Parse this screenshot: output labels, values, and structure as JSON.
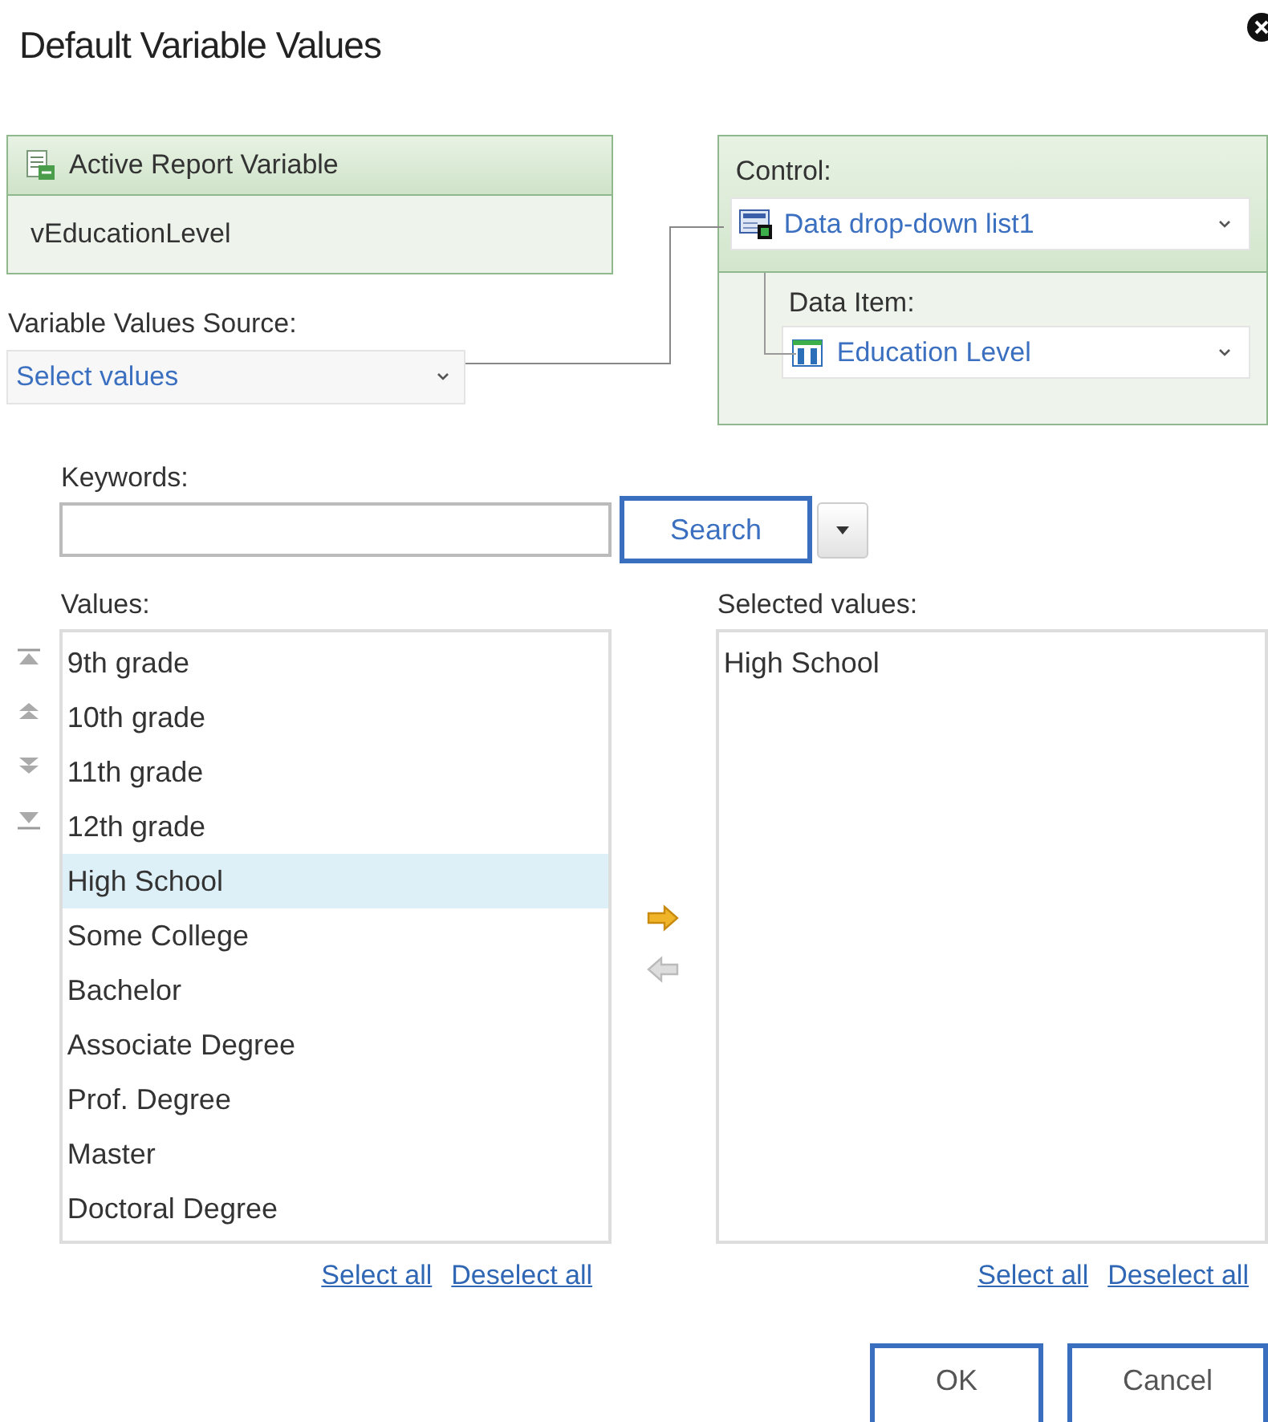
{
  "dialog": {
    "title": "Default Variable Values"
  },
  "variable_box": {
    "header": "Active Report Variable",
    "value": "vEducationLevel"
  },
  "source": {
    "label": "Variable Values Source:",
    "value": "Select values"
  },
  "control": {
    "label": "Control:",
    "value": "Data drop-down list1",
    "data_item_label": "Data Item:",
    "data_item_value": "Education Level"
  },
  "keywords": {
    "label": "Keywords:"
  },
  "search_button": "Search",
  "values": {
    "label": "Values:",
    "select_all": "Select all",
    "deselect_all": "Deselect all",
    "items": [
      {
        "text": "9th grade",
        "selected": false
      },
      {
        "text": "10th grade",
        "selected": false
      },
      {
        "text": "11th grade",
        "selected": false
      },
      {
        "text": "12th grade",
        "selected": false
      },
      {
        "text": "High School",
        "selected": true
      },
      {
        "text": "Some College",
        "selected": false
      },
      {
        "text": "Bachelor",
        "selected": false
      },
      {
        "text": "Associate Degree",
        "selected": false
      },
      {
        "text": "Prof. Degree",
        "selected": false
      },
      {
        "text": "Master",
        "selected": false
      },
      {
        "text": "Doctoral Degree",
        "selected": false
      }
    ]
  },
  "transfer": [
    {
      "kind": "add",
      "disabled": false
    },
    {
      "kind": "remove",
      "disabled": true
    }
  ],
  "selected_values": {
    "label": "Selected values:",
    "select_all": "Select all",
    "deselect_all": "Deselect all",
    "items": [
      {
        "text": "High School",
        "selected": false
      }
    ]
  },
  "buttons": [
    "OK",
    "Cancel"
  ]
}
